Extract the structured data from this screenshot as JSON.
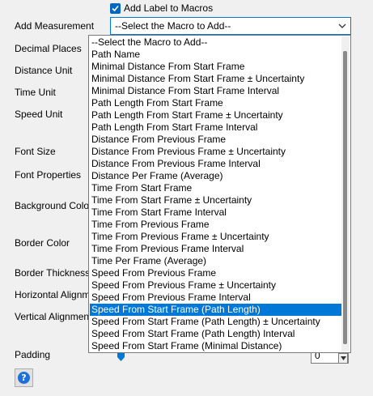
{
  "checkbox": {
    "label": "Add Label to Macros",
    "checked": true
  },
  "labels": {
    "add_measurement": "Add Measurement",
    "decimal_places": "Decimal Places",
    "distance_unit": "Distance Unit",
    "time_unit": "Time Unit",
    "speed_unit": "Speed Unit",
    "font_size": "Font Size",
    "font_properties": "Font Properties",
    "background_color": "Background Color",
    "border_color": "Border Color",
    "border_thickness": "Border Thickness",
    "horizontal_alignment": "Horizontal Alignment",
    "vertical_alignment": "Vertical Alignment",
    "padding": "Padding"
  },
  "select": {
    "value": "--Select the Macro to Add--"
  },
  "dropdown": {
    "selected_index": 22,
    "items": [
      "--Select the Macro to Add--",
      "Path Name",
      "Minimal Distance From Start Frame",
      "Minimal Distance From Start Frame ± Uncertainty",
      "Minimal Distance From Start Frame Interval",
      "Path Length From Start Frame",
      "Path Length From Start Frame ± Uncertainty",
      "Path Length From Start Frame Interval",
      "Distance From Previous Frame",
      "Distance From Previous Frame ± Uncertainty",
      "Distance From Previous Frame Interval",
      "Distance Per Frame (Average)",
      "Time From Start Frame",
      "Time From Start Frame ± Uncertainty",
      "Time From Start Frame Interval",
      "Time From Previous Frame",
      "Time From Previous Frame ± Uncertainty",
      "Time From Previous Frame Interval",
      "Time Per Frame (Average)",
      "Speed From Previous Frame",
      "Speed From Previous Frame ± Uncertainty",
      "Speed From Previous Frame Interval",
      "Speed From Start Frame (Path Length)",
      "Speed From Start Frame (Path Length) ± Uncertainty",
      "Speed From Start Frame (Path Length) Interval",
      "Speed From Start Frame (Minimal Distance)"
    ]
  },
  "padding_spin": {
    "value": "0"
  },
  "colors": {
    "accent": "#0078d7",
    "highlight": "#0078d7"
  },
  "icons": {
    "help": "help-icon",
    "chevron": "chevron-down-icon",
    "check": "check-icon"
  },
  "help_glyph": "?"
}
